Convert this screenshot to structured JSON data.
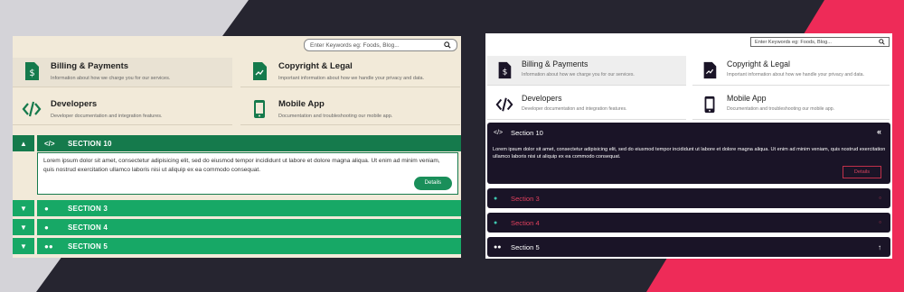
{
  "colors": {
    "left_green_dark": "#157a4c",
    "left_green": "#17a866",
    "left_cream": "#f2ead9",
    "right_dark": "#1a1427",
    "right_accent": "#e0405d",
    "bg_dark": "#262530",
    "bg_grey": "#d4d3d8",
    "bg_pink": "#ee2b58"
  },
  "left": {
    "search": {
      "placeholder": "Enter Keywords eg: Foods, Blog..."
    },
    "cards": [
      {
        "title": "Billing & Payments",
        "desc": "Information about how we charge you for our services.",
        "icon": "billing-icon"
      },
      {
        "title": "Copyright & Legal",
        "desc": "Important information about how we handle your privacy and data.",
        "icon": "legal-icon"
      },
      {
        "title": "Developers",
        "desc": "Developer documentation and integration features.",
        "icon": "code-icon"
      },
      {
        "title": "Mobile App",
        "desc": "Documentation and troubleshooting our mobile app.",
        "icon": "mobile-icon"
      }
    ],
    "sections": [
      {
        "label": "SECTION 10",
        "icon": "code-icon",
        "toggle": "chevron-up-icon",
        "expanded": true
      },
      {
        "label": "SECTION 3",
        "icon": "chat-icon",
        "toggle": "chevron-down-icon"
      },
      {
        "label": "SECTION 4",
        "icon": "apple-icon",
        "toggle": "chevron-down-icon"
      },
      {
        "label": "SECTION 5",
        "icon": "users-icon",
        "toggle": "chevron-down-icon"
      }
    ],
    "body": "Lorem ipsum dolor sit amet, consectetur adipisicing elit, sed do eiusmod tempor incididunt ut labore et dolore magna aliqua. Ut enim ad minim veniam, quis nostrud exercitation ullamco laboris nisi ut aliquip ex ea commodo consequat.",
    "details_label": "Details"
  },
  "right": {
    "search": {
      "placeholder": "Enter Keywords eg: Foods, Blog..."
    },
    "cards": [
      {
        "title": "Billing & Payments",
        "desc": "Information about how we charge you for our services.",
        "icon": "billing-icon"
      },
      {
        "title": "Copyright & Legal",
        "desc": "Important information about how we handle your privacy and data.",
        "icon": "legal-icon"
      },
      {
        "title": "Developers",
        "desc": "Developer documentation and integration features.",
        "icon": "code-icon"
      },
      {
        "title": "Mobile App",
        "desc": "Documentation and troubleshooting our mobile app.",
        "icon": "mobile-icon"
      }
    ],
    "sections": [
      {
        "label": "Section 10",
        "icon": "code-icon",
        "toggle": "double-chevron-left-icon",
        "expanded": true
      },
      {
        "label": "Section 3",
        "icon": "chat-icon",
        "toggle": "circle-icon"
      },
      {
        "label": "Section 4",
        "icon": "apple-icon",
        "toggle": "circle-icon"
      },
      {
        "label": "Section 5",
        "icon": "users-icon",
        "toggle": "arrow-up-icon"
      }
    ],
    "body": "Lorem ipsum dolor sit amet, consectetur adipisicing elit, sed do eiusmod tempor incididunt ut labore et dolore magna aliqua. Ut enim ad minim veniam, quis nostrud exercitation ullamco laboris nisi ut aliquip ex ea commodo consequat.",
    "details_label": "Details"
  }
}
